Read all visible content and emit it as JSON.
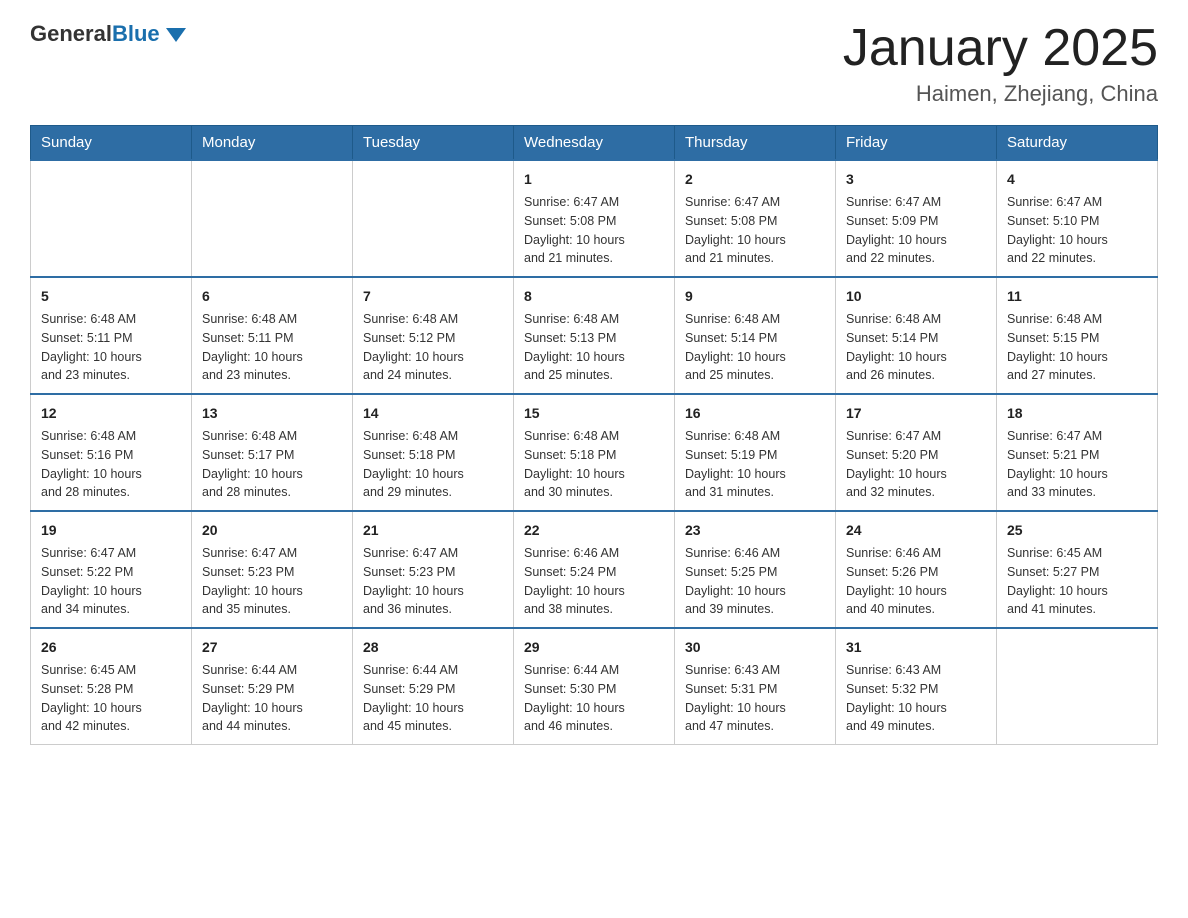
{
  "logo": {
    "text_general": "General",
    "text_blue": "Blue"
  },
  "header": {
    "title": "January 2025",
    "subtitle": "Haimen, Zhejiang, China"
  },
  "weekdays": [
    "Sunday",
    "Monday",
    "Tuesday",
    "Wednesday",
    "Thursday",
    "Friday",
    "Saturday"
  ],
  "weeks": [
    [
      {
        "day": "",
        "info": ""
      },
      {
        "day": "",
        "info": ""
      },
      {
        "day": "",
        "info": ""
      },
      {
        "day": "1",
        "info": "Sunrise: 6:47 AM\nSunset: 5:08 PM\nDaylight: 10 hours\nand 21 minutes."
      },
      {
        "day": "2",
        "info": "Sunrise: 6:47 AM\nSunset: 5:08 PM\nDaylight: 10 hours\nand 21 minutes."
      },
      {
        "day": "3",
        "info": "Sunrise: 6:47 AM\nSunset: 5:09 PM\nDaylight: 10 hours\nand 22 minutes."
      },
      {
        "day": "4",
        "info": "Sunrise: 6:47 AM\nSunset: 5:10 PM\nDaylight: 10 hours\nand 22 minutes."
      }
    ],
    [
      {
        "day": "5",
        "info": "Sunrise: 6:48 AM\nSunset: 5:11 PM\nDaylight: 10 hours\nand 23 minutes."
      },
      {
        "day": "6",
        "info": "Sunrise: 6:48 AM\nSunset: 5:11 PM\nDaylight: 10 hours\nand 23 minutes."
      },
      {
        "day": "7",
        "info": "Sunrise: 6:48 AM\nSunset: 5:12 PM\nDaylight: 10 hours\nand 24 minutes."
      },
      {
        "day": "8",
        "info": "Sunrise: 6:48 AM\nSunset: 5:13 PM\nDaylight: 10 hours\nand 25 minutes."
      },
      {
        "day": "9",
        "info": "Sunrise: 6:48 AM\nSunset: 5:14 PM\nDaylight: 10 hours\nand 25 minutes."
      },
      {
        "day": "10",
        "info": "Sunrise: 6:48 AM\nSunset: 5:14 PM\nDaylight: 10 hours\nand 26 minutes."
      },
      {
        "day": "11",
        "info": "Sunrise: 6:48 AM\nSunset: 5:15 PM\nDaylight: 10 hours\nand 27 minutes."
      }
    ],
    [
      {
        "day": "12",
        "info": "Sunrise: 6:48 AM\nSunset: 5:16 PM\nDaylight: 10 hours\nand 28 minutes."
      },
      {
        "day": "13",
        "info": "Sunrise: 6:48 AM\nSunset: 5:17 PM\nDaylight: 10 hours\nand 28 minutes."
      },
      {
        "day": "14",
        "info": "Sunrise: 6:48 AM\nSunset: 5:18 PM\nDaylight: 10 hours\nand 29 minutes."
      },
      {
        "day": "15",
        "info": "Sunrise: 6:48 AM\nSunset: 5:18 PM\nDaylight: 10 hours\nand 30 minutes."
      },
      {
        "day": "16",
        "info": "Sunrise: 6:48 AM\nSunset: 5:19 PM\nDaylight: 10 hours\nand 31 minutes."
      },
      {
        "day": "17",
        "info": "Sunrise: 6:47 AM\nSunset: 5:20 PM\nDaylight: 10 hours\nand 32 minutes."
      },
      {
        "day": "18",
        "info": "Sunrise: 6:47 AM\nSunset: 5:21 PM\nDaylight: 10 hours\nand 33 minutes."
      }
    ],
    [
      {
        "day": "19",
        "info": "Sunrise: 6:47 AM\nSunset: 5:22 PM\nDaylight: 10 hours\nand 34 minutes."
      },
      {
        "day": "20",
        "info": "Sunrise: 6:47 AM\nSunset: 5:23 PM\nDaylight: 10 hours\nand 35 minutes."
      },
      {
        "day": "21",
        "info": "Sunrise: 6:47 AM\nSunset: 5:23 PM\nDaylight: 10 hours\nand 36 minutes."
      },
      {
        "day": "22",
        "info": "Sunrise: 6:46 AM\nSunset: 5:24 PM\nDaylight: 10 hours\nand 38 minutes."
      },
      {
        "day": "23",
        "info": "Sunrise: 6:46 AM\nSunset: 5:25 PM\nDaylight: 10 hours\nand 39 minutes."
      },
      {
        "day": "24",
        "info": "Sunrise: 6:46 AM\nSunset: 5:26 PM\nDaylight: 10 hours\nand 40 minutes."
      },
      {
        "day": "25",
        "info": "Sunrise: 6:45 AM\nSunset: 5:27 PM\nDaylight: 10 hours\nand 41 minutes."
      }
    ],
    [
      {
        "day": "26",
        "info": "Sunrise: 6:45 AM\nSunset: 5:28 PM\nDaylight: 10 hours\nand 42 minutes."
      },
      {
        "day": "27",
        "info": "Sunrise: 6:44 AM\nSunset: 5:29 PM\nDaylight: 10 hours\nand 44 minutes."
      },
      {
        "day": "28",
        "info": "Sunrise: 6:44 AM\nSunset: 5:29 PM\nDaylight: 10 hours\nand 45 minutes."
      },
      {
        "day": "29",
        "info": "Sunrise: 6:44 AM\nSunset: 5:30 PM\nDaylight: 10 hours\nand 46 minutes."
      },
      {
        "day": "30",
        "info": "Sunrise: 6:43 AM\nSunset: 5:31 PM\nDaylight: 10 hours\nand 47 minutes."
      },
      {
        "day": "31",
        "info": "Sunrise: 6:43 AM\nSunset: 5:32 PM\nDaylight: 10 hours\nand 49 minutes."
      },
      {
        "day": "",
        "info": ""
      }
    ]
  ]
}
